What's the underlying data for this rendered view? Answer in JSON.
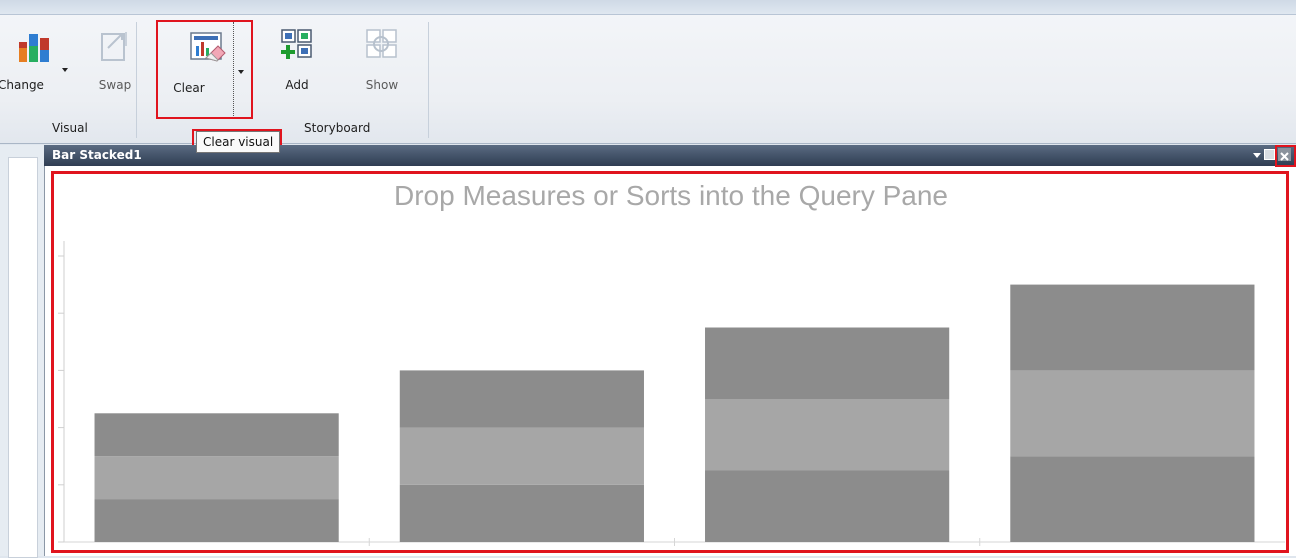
{
  "ribbon": {
    "buttons": {
      "change": "Change",
      "swap": "Swap",
      "clear": "Clear",
      "add": "Add",
      "show": "Show"
    },
    "groups": {
      "visual": "Visual",
      "storyboard": "Storyboard"
    },
    "tooltip": "Clear visual"
  },
  "visual_window": {
    "title": "Bar Stacked1"
  },
  "chart_data": {
    "type": "bar",
    "stacked": true,
    "title": "Drop Measures or Sorts into the Query Pane",
    "categories": [
      "",
      "",
      "",
      ""
    ],
    "series": [
      {
        "values": [
          0.75,
          1.0,
          1.25,
          1.5
        ]
      },
      {
        "values": [
          0.75,
          1.0,
          1.25,
          1.5
        ]
      },
      {
        "values": [
          0.75,
          1.0,
          1.25,
          1.5
        ]
      }
    ],
    "ylim": [
      0,
      5
    ],
    "colors": [
      "#8c8c8c",
      "#a6a6a6",
      "#8c8c8c"
    ],
    "axis_tick_labels_visible": false
  },
  "highlight_color": "#e0141e"
}
